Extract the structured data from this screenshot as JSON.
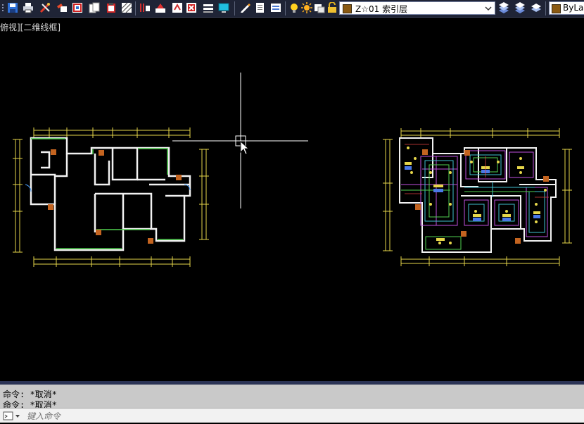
{
  "toolbar": {
    "icons": [
      "save-icon",
      "print-icon",
      "tools-icon",
      "match-properties-icon",
      "block-icon",
      "copy-icon",
      "paste-icon",
      "hatch-icon",
      "layer-off-icon",
      "layer-isolate-icon",
      "delete-icon",
      "layer-walk-icon",
      "monitor-icon",
      "pen-icon",
      "layer-manager-icon",
      "bulb-icon",
      "sun-icon",
      "freeze-icon",
      "lock-icon"
    ],
    "layer": {
      "name": "Z☆01 索引层",
      "color": "#8b5a12"
    },
    "color_combo": {
      "label": "ByLa",
      "color": "#8b5a12"
    }
  },
  "viewport": {
    "label": "俯视][二维线框]"
  },
  "command": {
    "history": [
      "命令: *取消*",
      "命令: *取消*"
    ],
    "placeholder": "键入命令"
  }
}
